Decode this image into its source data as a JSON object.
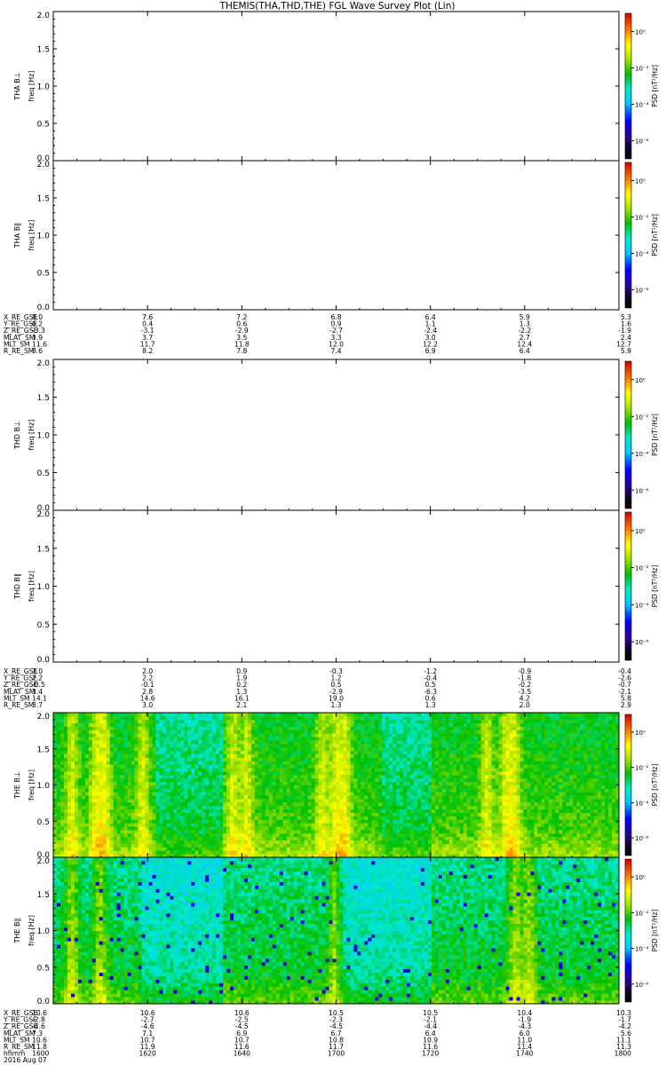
{
  "title": "THEMIS(THA,THD,THE) FGL Wave Survey Plot (Lin)",
  "colorbar": {
    "label": "PSD [nT²/Hz]",
    "ticks": [
      "10⁰",
      "10⁻²",
      "10⁻⁴",
      "10⁻⁶"
    ],
    "log_range": [
      -7,
      1
    ],
    "tick_exps": [
      0,
      -2,
      -4,
      -6
    ]
  },
  "chart_data": [
    {
      "type": "heatmap",
      "name": "THA B⊥",
      "ylabel_top": "THA B⊥",
      "ylabel": "freq [Hz]",
      "ylim": [
        0,
        2
      ],
      "yticks": [
        "0.0",
        "0.5",
        "1.0",
        "1.5",
        "2.0"
      ],
      "has_data": false
    },
    {
      "type": "heatmap",
      "name": "THA B∥",
      "ylabel_top": "THA B∥",
      "ylabel": "freq [Hz]",
      "ylim": [
        0,
        2
      ],
      "yticks": [
        "0.0",
        "0.5",
        "1.0",
        "1.5",
        "2.0"
      ],
      "has_data": false
    },
    {
      "type": "heatmap",
      "name": "THD B⊥",
      "ylabel_top": "THD B⊥",
      "ylabel": "freq [Hz]",
      "ylim": [
        0,
        2
      ],
      "yticks": [
        "0.0",
        "0.5",
        "1.0",
        "1.5",
        "2.0"
      ],
      "has_data": false
    },
    {
      "type": "heatmap",
      "name": "THD B∥",
      "ylabel_top": "THD B∥",
      "ylabel": "freq [Hz]",
      "ylim": [
        0,
        2
      ],
      "yticks": [
        "0.0",
        "0.5",
        "1.0",
        "1.5",
        "2.0"
      ],
      "has_data": false
    },
    {
      "type": "heatmap",
      "name": "THE B⊥",
      "ylabel_top": "THE B⊥",
      "ylabel": "freq [Hz]",
      "ylim": [
        0,
        2
      ],
      "yticks": [
        "0.0",
        "0.5",
        "1.0",
        "1.5",
        "2.0"
      ],
      "has_data": true,
      "x_range_hhmm": [
        "1600",
        "1800"
      ],
      "features": "broadband green-yellow PSD with enhanced yellow-red bands near 1611, 1619, 1638, 1657, 1700, 1732 and 1738; low-frequency power strongest below 0.5 Hz; quieter green/cyan intervals near 1622-1636 and 1710-1720"
    },
    {
      "type": "heatmap",
      "name": "THE B∥",
      "ylabel_top": "THE B∥",
      "ylabel": "freq [Hz]",
      "ylim": [
        0,
        2
      ],
      "yticks": [
        "0.0",
        "0.5",
        "1.0",
        "1.5",
        "2.0"
      ],
      "has_data": true,
      "x_range_hhmm": [
        "1600",
        "1800"
      ],
      "features": "mostly green-cyan with scattered blue pixels; yellow-red bands near 1604, 1610, 1738; quieter cyan intervals near 1619-1636 and 1700-1720"
    }
  ],
  "ephemeris": [
    {
      "rows": [
        {
          "label": "X_RE_GSE",
          "values": [
            "8.0",
            "7.6",
            "7.2",
            "6.8",
            "6.4",
            "5.9",
            "5.3"
          ]
        },
        {
          "label": "Y_RE_GSE",
          "values": [
            "0.2",
            "0.4",
            "0.6",
            "0.9",
            "1.1",
            "1.3",
            "1.6"
          ]
        },
        {
          "label": "Z_RE_GSE",
          "values": [
            "-3.3",
            "-3.1",
            "-2.9",
            "-2.7",
            "-2.4",
            "-2.2",
            "-1.9"
          ]
        },
        {
          "label": "MLAT_SM",
          "values": [
            "3.9",
            "3.7",
            "3.5",
            "3.3",
            "3.0",
            "2.7",
            "2.4"
          ]
        },
        {
          "label": "MLT_SM",
          "values": [
            "11.6",
            "11.7",
            "11.8",
            "12.0",
            "12.2",
            "12.4",
            "12.7"
          ]
        },
        {
          "label": "R_RE_SM",
          "values": [
            "8.6",
            "8.2",
            "7.8",
            "7.4",
            "6.9",
            "6.4",
            "5.9"
          ]
        }
      ]
    },
    {
      "rows": [
        {
          "label": "X_RE_GSE",
          "values": [
            "3.0",
            "2.0",
            "0.9",
            "-0.3",
            "-1.2",
            "-0.9",
            "-0.4"
          ]
        },
        {
          "label": "Y_RE_GSE",
          "values": [
            "2.2",
            "2.2",
            "1.9",
            "1.2",
            "-0.4",
            "-1.8",
            "-2.6"
          ]
        },
        {
          "label": "Z_RE_GSE",
          "values": [
            "-0.5",
            "-0.1",
            "0.2",
            "0.5",
            "0.5",
            "-0.2",
            "-0.7"
          ]
        },
        {
          "label": "MLAT_SM",
          "values": [
            "3.4",
            "2.8",
            "1.3",
            "-2.9",
            "-6.3",
            "-3.5",
            "-2.1"
          ]
        },
        {
          "label": "MLT_SM",
          "values": [
            "14.1",
            "14.6",
            "16.1",
            "19.0",
            "0.6",
            "4.2",
            "5.8"
          ]
        },
        {
          "label": "R_RE_SM",
          "values": [
            "3.7",
            "3.0",
            "2.1",
            "1.3",
            "1.3",
            "2.0",
            "2.9"
          ]
        }
      ]
    },
    {
      "rows": [
        {
          "label": "X_RE_GSE",
          "values": [
            "10.6",
            "10.6",
            "10.6",
            "10.5",
            "10.5",
            "10.4",
            "10.3"
          ]
        },
        {
          "label": "Y_RE_GSE",
          "values": [
            "-2.8",
            "-2.7",
            "-2.5",
            "-2.3",
            "-2.1",
            "-1.9",
            "-1.7"
          ]
        },
        {
          "label": "Z_RE_GSE",
          "values": [
            "-4.6",
            "-4.6",
            "-4.5",
            "-4.5",
            "-4.4",
            "-4.3",
            "-4.2"
          ]
        },
        {
          "label": "MLAT_SM",
          "values": [
            "7.3",
            "7.1",
            "6.9",
            "6.7",
            "6.4",
            "6.0",
            "5.6"
          ]
        },
        {
          "label": "MLT_SM",
          "values": [
            "10.6",
            "10.7",
            "10.7",
            "10.8",
            "10.9",
            "11.0",
            "11.1"
          ]
        },
        {
          "label": "R_RE_SM",
          "values": [
            "11.8",
            "11.9",
            "11.6",
            "11.7",
            "11.6",
            "11.4",
            "11.3"
          ]
        },
        {
          "label": "hhmm",
          "values": [
            "1600",
            "1620",
            "1640",
            "1700",
            "1720",
            "1740",
            "1800"
          ]
        }
      ],
      "date": "2016 Aug 07"
    }
  ]
}
